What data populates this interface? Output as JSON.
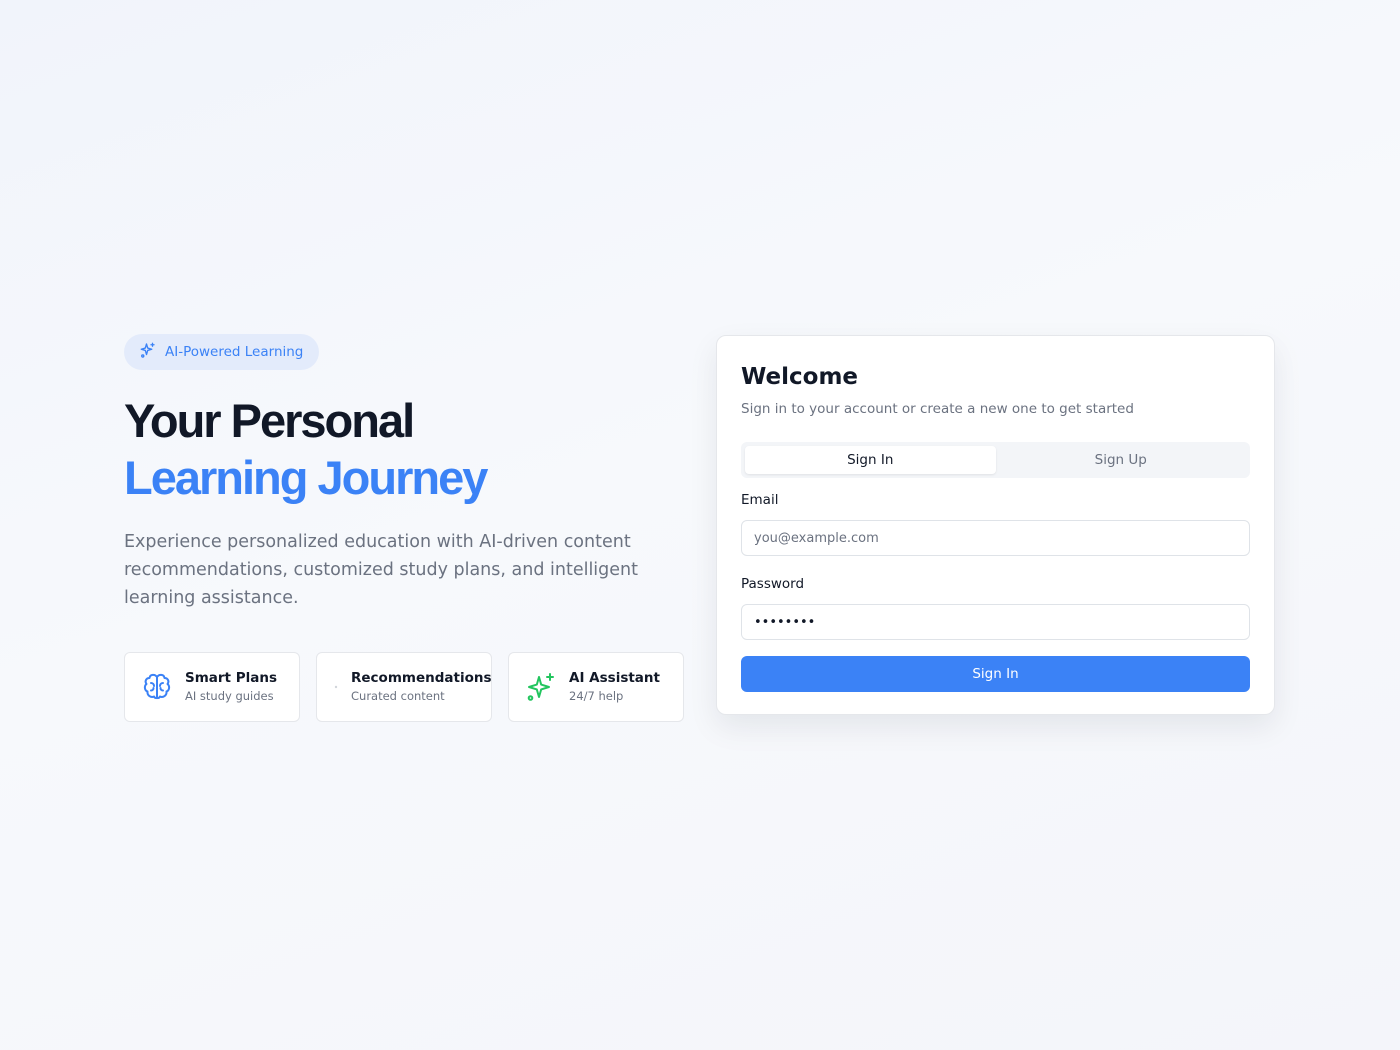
{
  "hero": {
    "badge": {
      "icon": "sparkles-icon",
      "label": "AI-Powered Learning"
    },
    "headline_line1": "Your Personal",
    "headline_line2": "Learning Journey",
    "description": "Experience personalized education with AI-driven content recommendations, customized study plans, and intelligent learning assistance.",
    "features": [
      {
        "icon": "brain-icon",
        "title": "Smart Plans",
        "subtitle": "AI study guides"
      },
      {
        "icon": "dot-icon",
        "title": "Recommendations",
        "subtitle": "Curated content"
      },
      {
        "icon": "sparkles-icon",
        "title": "AI Assistant",
        "subtitle": "24/7 help"
      }
    ]
  },
  "auth": {
    "title": "Welcome",
    "subtitle": "Sign in to your account or create a new one to get started",
    "tabs": [
      {
        "label": "Sign In",
        "active": true
      },
      {
        "label": "Sign Up",
        "active": false
      }
    ],
    "email": {
      "label": "Email",
      "placeholder": "you@example.com",
      "value": ""
    },
    "password": {
      "label": "Password",
      "value": "••••••••"
    },
    "submit_label": "Sign In"
  },
  "colors": {
    "accent": "#3b82f6",
    "heading": "#111827",
    "muted": "#6b7280",
    "success": "#22c55e",
    "badge_bg": "#e3ebfb"
  }
}
